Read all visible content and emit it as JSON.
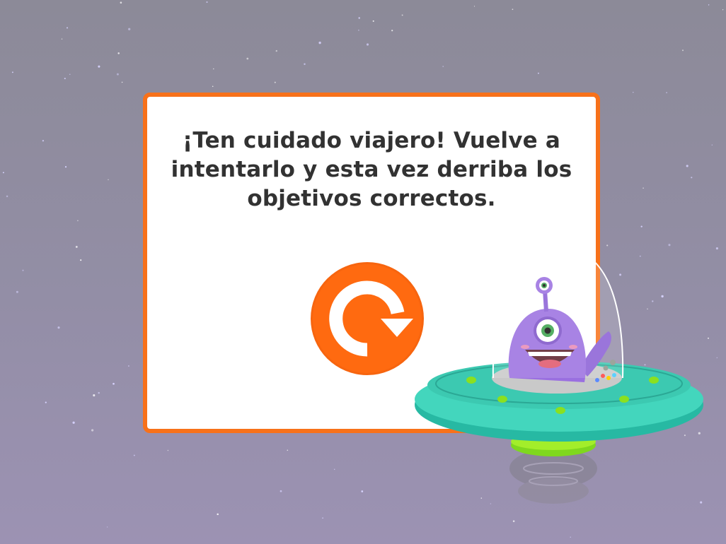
{
  "dialog": {
    "message": "¡Ten cuidado viajero! Vuelve a intentarlo y esta vez derriba los objetivos correctos.",
    "retry_icon": "retry-arrow-icon"
  },
  "scene": {
    "character": "purple-one-eyed-alien",
    "vehicle": "flying-saucer"
  },
  "colors": {
    "accent": "#f7711a",
    "background": "#8f8c9e",
    "dialog_bg": "#ffffff",
    "text": "#323232",
    "ufo": "#3fd9bd",
    "alien": "#9a6fe0"
  }
}
